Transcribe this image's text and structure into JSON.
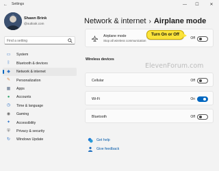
{
  "window": {
    "back_icon": "back-arrow-icon",
    "title": "Settings",
    "minimize": "—",
    "maximize": "☐",
    "close": "✕"
  },
  "user": {
    "name": "Shawn Brink",
    "email": "@outlook.com"
  },
  "search": {
    "placeholder": "Find a setting"
  },
  "nav": {
    "items": [
      {
        "label": "System",
        "icon": "monitor-icon",
        "color": "#2f73c7"
      },
      {
        "label": "Bluetooth & devices",
        "icon": "bluetooth-icon",
        "color": "#2f73c7"
      },
      {
        "label": "Network & internet",
        "icon": "network-icon",
        "color": "#2f73c7"
      },
      {
        "label": "Personalization",
        "icon": "brush-icon",
        "color": "#d77c3a"
      },
      {
        "label": "Apps",
        "icon": "apps-icon",
        "color": "#5a6e8a"
      },
      {
        "label": "Accounts",
        "icon": "person-icon",
        "color": "#2ea36b"
      },
      {
        "label": "Time & language",
        "icon": "clock-globe-icon",
        "color": "#2f73c7"
      },
      {
        "label": "Gaming",
        "icon": "controller-icon",
        "color": "#6b6b6b"
      },
      {
        "label": "Accessibility",
        "icon": "accessibility-icon",
        "color": "#2f73c7"
      },
      {
        "label": "Privacy & security",
        "icon": "shield-icon",
        "color": "#6b6b6b"
      },
      {
        "label": "Windows Update",
        "icon": "update-icon",
        "color": "#2f73c7"
      }
    ],
    "active_index": 2
  },
  "breadcrumb": {
    "parent": "Network & internet",
    "separator": "›",
    "current": "Airplane mode"
  },
  "airplane": {
    "icon": "airplane-icon",
    "title": "Airplane mode",
    "description": "Stop all wireless communication",
    "state": "Off",
    "on": false
  },
  "wireless": {
    "heading": "Wireless devices",
    "rows": [
      {
        "label": "Cellular",
        "state": "Off",
        "on": false
      },
      {
        "label": "Wi-Fi",
        "state": "On",
        "on": true
      },
      {
        "label": "Bluetooth",
        "state": "Off",
        "on": false
      }
    ]
  },
  "links": [
    {
      "label": "Get help",
      "icon": "help-icon"
    },
    {
      "label": "Give feedback",
      "icon": "feedback-icon"
    }
  ],
  "callout": "Turn On or Off",
  "watermark": "ElevenForum.com",
  "colors": {
    "accent": "#0067c0",
    "callout": "#fbe33a"
  }
}
